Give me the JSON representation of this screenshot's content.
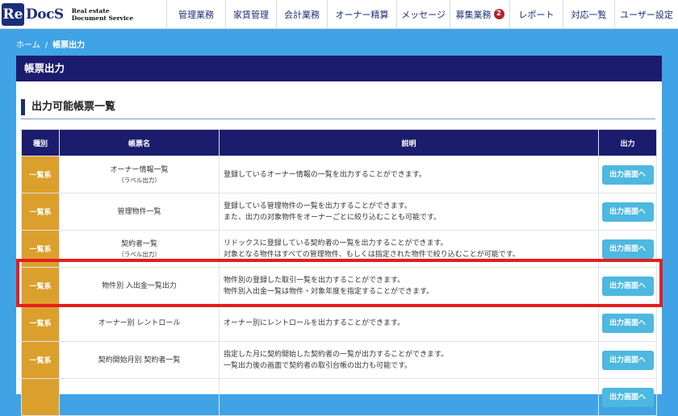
{
  "header": {
    "logo_main": "ReDocS",
    "logo_re": "Re",
    "logo_docs": "DocS",
    "logo_sub_line1": "Real estate",
    "logo_sub_line2": "Document Service",
    "nav": [
      {
        "label": "管理業務"
      },
      {
        "label": "家賃管理"
      },
      {
        "label": "会計業務"
      },
      {
        "label": "オーナー精算"
      },
      {
        "label": "メッセージ"
      },
      {
        "label": "募集業務",
        "badge": "2"
      },
      {
        "label": "レポート"
      },
      {
        "label": "対応一覧"
      },
      {
        "label": "ユーザー設定"
      }
    ]
  },
  "breadcrumb": {
    "home": "ホーム",
    "separator": "/",
    "current": "帳票出力"
  },
  "panel": {
    "title": "帳票出力",
    "section_title": "出力可能帳票一覧"
  },
  "table": {
    "headers": {
      "type": "種別",
      "name": "帳票名",
      "desc": "説明",
      "output": "出力"
    },
    "rows": [
      {
        "type": "一覧系",
        "name": "オーナー情報一覧",
        "sub": "（ラベル出力）",
        "desc1": "登録しているオーナー情報の一覧を出力することができます。",
        "desc2": "",
        "button": "出力画面へ"
      },
      {
        "type": "一覧系",
        "name": "管理物件一覧",
        "sub": "",
        "desc1": "登録している管理物件の一覧を出力することができます。",
        "desc2": "また、出力の対象物件をオーナーごとに絞り込むことも可能です。",
        "button": "出力画面へ"
      },
      {
        "type": "一覧系",
        "name": "契約者一覧",
        "sub": "（ラベル出力）",
        "desc1": "リドックスに登録している契約者の一覧を出力することができます。",
        "desc2": "対象となる物件はすべての管理物件、もしくは指定された物件で絞り込むことが可能です。",
        "button": "出力画面へ"
      },
      {
        "type": "一覧系",
        "name": "物件別 入出金一覧出力",
        "sub": "",
        "desc1": "物件別の登録した取引一覧を出力することができます。",
        "desc2": "物件別入出金一覧は物件・対象年度を指定することができます。",
        "button": "出力画面へ"
      },
      {
        "type": "一覧系",
        "name": "オーナー別 レントロール",
        "sub": "",
        "desc1": "オーナー別にレントロールを出力することができます。",
        "desc2": "",
        "button": "出力画面へ"
      },
      {
        "type": "一覧系",
        "name": "契約開始月別 契約者一覧",
        "sub": "",
        "desc1": "指定した月に契約開始した契約者の一覧が出力することができます。",
        "desc2": "一覧出力後の画面で契約者の取引台帳の出力も可能です。",
        "button": "出力画面へ"
      },
      {
        "type": "",
        "name": "",
        "sub": "",
        "desc1": "",
        "desc2": "",
        "button": "出力画面へ"
      }
    ]
  },
  "colors": {
    "nav_text": "#1b2f79",
    "page_bg": "#3fa3e6",
    "panel_header": "#1c1c6e",
    "type_cell": "#dba02c",
    "button": "#4db8e0",
    "highlight": "#e41e1e",
    "badge": "#b8202c"
  }
}
